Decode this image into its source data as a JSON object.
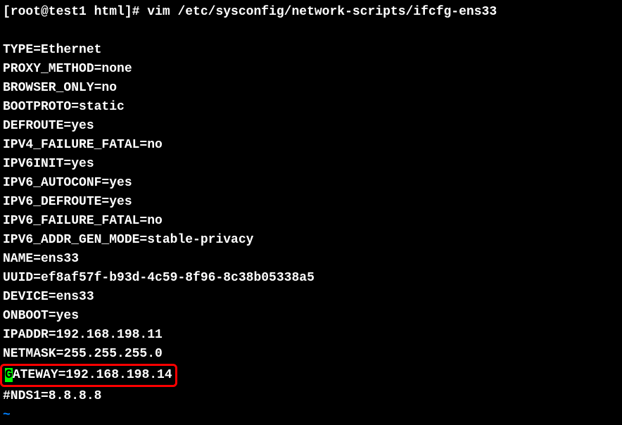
{
  "prompt": {
    "full": "[root@test1 html]# vim /etc/sysconfig/network-scripts/ifcfg-ens33"
  },
  "file_content": {
    "lines": [
      "TYPE=Ethernet",
      "PROXY_METHOD=none",
      "BROWSER_ONLY=no",
      "BOOTPROTO=static",
      "DEFROUTE=yes",
      "IPV4_FAILURE_FATAL=no",
      "IPV6INIT=yes",
      "IPV6_AUTOCONF=yes",
      "IPV6_DEFROUTE=yes",
      "IPV6_FAILURE_FATAL=no",
      "IPV6_ADDR_GEN_MODE=stable-privacy",
      "NAME=ens33",
      "UUID=ef8af57f-b93d-4c59-8f96-8c38b05338a5",
      "DEVICE=ens33",
      "ONBOOT=yes",
      "IPADDR=192.168.198.11",
      "NETMASK=255.255.255.0"
    ],
    "highlighted_cursor_char": "G",
    "highlighted_rest": "ATEWAY=192.168.198.14",
    "last_line": "#NDS1=8.8.8.8",
    "tilde": "~"
  }
}
